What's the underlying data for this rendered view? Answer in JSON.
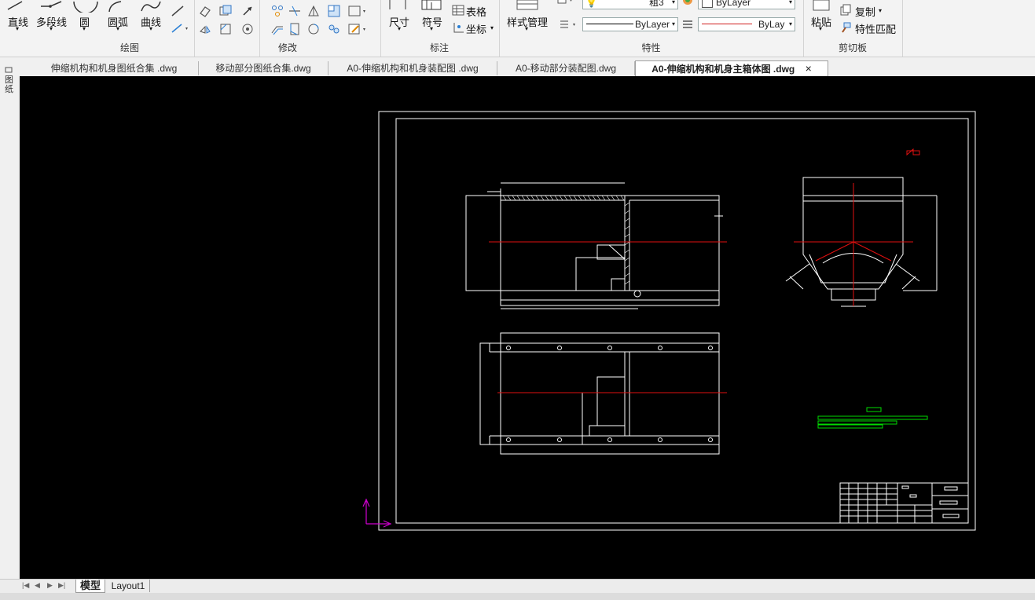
{
  "ribbon": {
    "draw_panel": {
      "title": "绘图",
      "line": "直线",
      "polyline": "多段线",
      "circle": "圆",
      "arc": "圆弧",
      "curve": "曲线"
    },
    "modify_panel": {
      "title": "修改"
    },
    "annotate_panel": {
      "title": "标注",
      "dimension": "尺寸",
      "symbol": "符号",
      "table": "表格",
      "coordinate": "坐标"
    },
    "properties_panel": {
      "title": "特性",
      "style_manager": "样式管理",
      "layer_combo_partial": "粗3",
      "color_value": "ByLayer",
      "linetype_value": "ByLayer",
      "lineweight_value": "ByLay"
    },
    "clipboard_panel": {
      "title": "剪切板",
      "paste": "粘贴",
      "copy": "复制",
      "match_properties": "特性匹配"
    }
  },
  "left_panel_label": "图纸",
  "tabs": [
    {
      "label": "伸缩机构和机身图纸合集 .dwg",
      "active": false
    },
    {
      "label": "移动部分图纸合集.dwg",
      "active": false
    },
    {
      "label": "A0-伸缩机构和机身装配图 .dwg",
      "active": false
    },
    {
      "label": "A0-移动部分装配图.dwg",
      "active": false
    },
    {
      "label": "A0-伸缩机构和机身主箱体图 .dwg",
      "active": true
    }
  ],
  "tab_close": "×",
  "layout_tabs": [
    {
      "label": "模型",
      "active": true
    },
    {
      "label": "Layout1",
      "active": false
    }
  ],
  "colors": {
    "canvas": "#000000",
    "geometry": "#ffffff",
    "centerline": "#e01010",
    "annotation": "#00dd00",
    "ucs": "#d000d0"
  }
}
